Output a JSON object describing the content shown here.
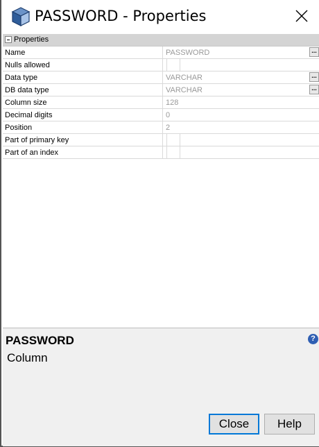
{
  "window": {
    "title": "PASSWORD - Properties"
  },
  "grid": {
    "section_title": "Properties",
    "rows": [
      {
        "label": "Name",
        "value": "PASSWORD"
      },
      {
        "label": "Nulls allowed",
        "value": ""
      },
      {
        "label": "Data type",
        "value": "VARCHAR"
      },
      {
        "label": "DB data type",
        "value": "VARCHAR"
      },
      {
        "label": "Column size",
        "value": "128"
      },
      {
        "label": "Decimal digits",
        "value": "0"
      },
      {
        "label": "Position",
        "value": "2"
      },
      {
        "label": "Part of primary key",
        "value": ""
      },
      {
        "label": "Part of an index",
        "value": ""
      }
    ],
    "ellipsis_label": "..."
  },
  "info": {
    "name": "PASSWORD",
    "type": "Column",
    "help_glyph": "?"
  },
  "buttons": {
    "close": "Close",
    "help": "Help"
  }
}
